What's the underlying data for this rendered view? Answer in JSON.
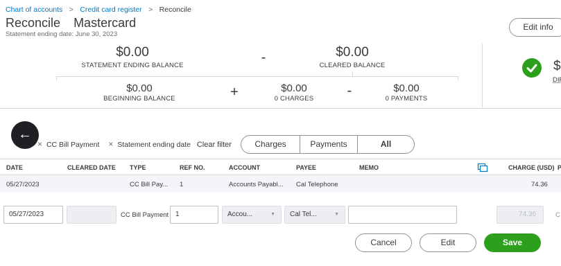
{
  "breadcrumb": {
    "items": [
      "Chart of accounts",
      "Credit card register",
      "Reconcile"
    ],
    "separator": ">"
  },
  "header": {
    "title_prefix": "Reconcile",
    "account_name": "Mastercard",
    "statement_date": "Statement ending date: June 30, 2023",
    "edit_info_label": "Edit info"
  },
  "summary": {
    "statement_ending_balance": {
      "amount": "$0.00",
      "label": "STATEMENT ENDING BALANCE"
    },
    "cleared_balance": {
      "amount": "$0.00",
      "label": "CLEARED BALANCE"
    },
    "beginning_balance": {
      "amount": "$0.00",
      "label": "BEGINNING BALANCE"
    },
    "charges": {
      "amount": "$0.00",
      "label": "0 CHARGES"
    },
    "payments": {
      "amount": "$0.00",
      "label": "0 PAYMENTS"
    },
    "minus_op": "-",
    "plus_op": "+",
    "difference": {
      "amount_partial": "$",
      "label_partial": "DIF"
    }
  },
  "back_button_icon": "arrow-left-icon",
  "filters": {
    "chips": [
      "CC Bill Payment",
      "Statement ending date"
    ],
    "remove_glyph": "×",
    "clear_label": "Clear filter"
  },
  "tabs": [
    {
      "label": "Charges",
      "active": false
    },
    {
      "label": "Payments",
      "active": false
    },
    {
      "label": "All",
      "active": true
    }
  ],
  "table": {
    "columns": [
      "DATE",
      "CLEARED DATE",
      "TYPE",
      "REF NO.",
      "ACCOUNT",
      "PAYEE",
      "MEMO",
      "CHARGE (USD)",
      "P"
    ],
    "rows": [
      {
        "date": "05/27/2023",
        "cleared_date": "",
        "type": "CC Bill Pay...",
        "ref_no": "1",
        "account": "Accounts Payabl...",
        "payee": "Cal Telephone",
        "memo": "",
        "charge": "74.36"
      }
    ]
  },
  "edit_row": {
    "date": "05/27/2023",
    "cleared_date": "",
    "type": "CC Bill Payment",
    "ref_no": "1",
    "account": "Accou...",
    "payee": "Cal Tel...",
    "memo": "",
    "charge": "74.36",
    "trailing": "C"
  },
  "actions": {
    "cancel_label": "Cancel",
    "edit_label": "Edit",
    "save_label": "Save"
  },
  "colors": {
    "link": "#0077c5",
    "green": "#2ca01c",
    "text": "#393a3d"
  }
}
